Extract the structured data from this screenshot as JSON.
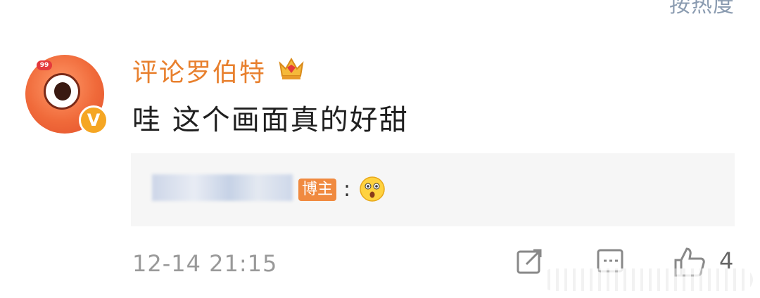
{
  "header": {
    "sort_label": "按热度"
  },
  "comment": {
    "username": "评论罗伯特",
    "avatar_badge": "99",
    "verified_mark": "V",
    "text": "哇 这个画面真的好甜",
    "reply": {
      "tag": "博主",
      "colon": ":",
      "emoji": "surprised-face-emoji"
    },
    "timestamp": "12-14 21:15",
    "like_count": "4"
  },
  "icons": {
    "crown": "crown-icon",
    "share": "share-icon",
    "comment": "comment-icon",
    "like": "thumbs-up-icon"
  },
  "colors": {
    "username": "#e8802e",
    "verified": "#f5a623",
    "tag": "#f08a40",
    "muted": "#999999"
  }
}
